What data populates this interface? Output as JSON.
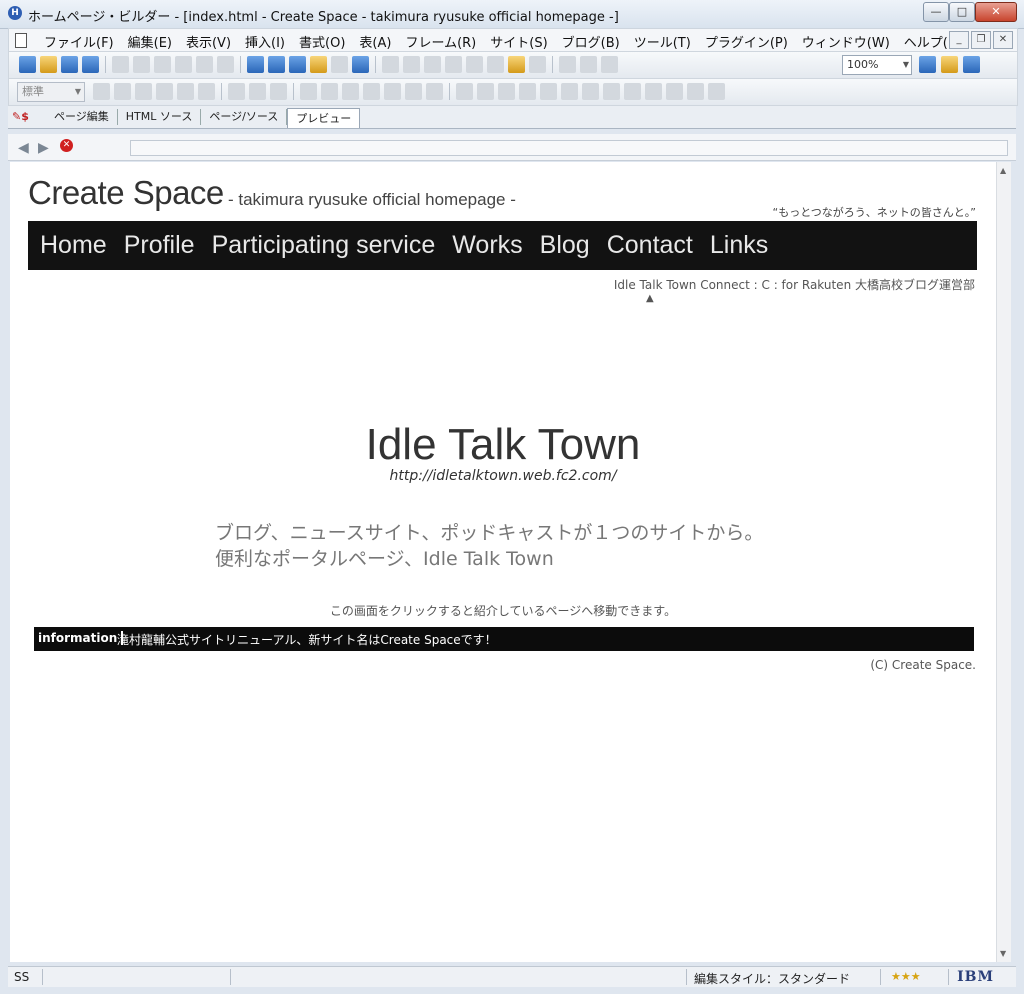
{
  "window": {
    "title": "ホームページ・ビルダー - [index.html - Create Space - takimura ryusuke official homepage -]",
    "min_label": "—",
    "max_label": "□",
    "close_label": "✕"
  },
  "menubar": {
    "items": [
      "ファイル(F)",
      "編集(E)",
      "表示(V)",
      "挿入(I)",
      "書式(O)",
      "表(A)",
      "フレーム(R)",
      "サイト(S)",
      "ブログ(B)",
      "ツール(T)",
      "プラグイン(P)",
      "ウィンドウ(W)",
      "ヘルプ(H)"
    ]
  },
  "toolbar": {
    "zoom": "100%",
    "paragraph_style": "標準"
  },
  "view_tabs": {
    "items": [
      "ページ編集",
      "HTML ソース",
      "ページ/ソース",
      "プレビュー"
    ],
    "active": "プレビュー"
  },
  "site": {
    "title": "Create Space",
    "subtitle": "- takimura ryusuke official homepage -",
    "tagline": "“もっとつながろう、ネットの皆さんと。”",
    "nav": [
      "Home",
      "Profile",
      "Participating service",
      "Works",
      "Blog",
      "Contact",
      "Links"
    ],
    "ticker": "Idle Talk Town  Connect : C : for Rakuten  大橋高校ブログ運営部",
    "ticker_caret": "▲",
    "feature": {
      "title": "Idle Talk Town",
      "url": "http://idletalktown.web.fc2.com/",
      "desc_line1": "ブログ、ニュースサイト、ポッドキャストが１つのサイトから。",
      "desc_line2": "便利なポータルページ、Idle Talk Town",
      "click_note": "この画面をクリックすると紹介しているページへ移動できます。"
    },
    "info": {
      "label": "information",
      "text": "滝村龍輔公式サイトリニューアル、新サイト名はCreate Spaceです！"
    },
    "copyright": "(C) Create Space."
  },
  "statusbar": {
    "left": "SS",
    "edit_style": "編集スタイル：スタンダード",
    "stars": "★★★",
    "brand": "IBM"
  },
  "colors": {
    "navbar_bg": "#121212",
    "info_bar_bg": "#0c0c0c",
    "chrome_bg": "#dfe6ef"
  }
}
